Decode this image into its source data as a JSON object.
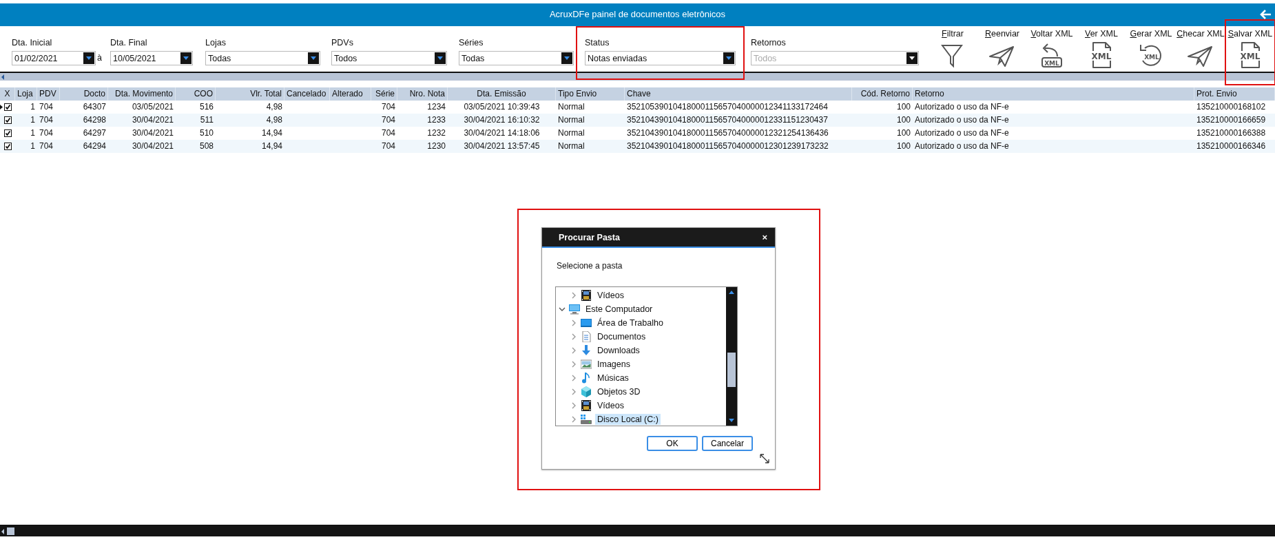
{
  "window": {
    "title": "AcruxDFe painel de documentos eletrônicos"
  },
  "filters": [
    {
      "kind": "field",
      "label": "Dta. Inicial",
      "value": "01/02/2021",
      "disabled": false,
      "highlighted": false
    },
    {
      "kind": "separator",
      "text": "à"
    },
    {
      "kind": "field",
      "label": "Dta. Final",
      "value": "10/05/2021",
      "disabled": false,
      "highlighted": false
    },
    {
      "kind": "field",
      "label": "Lojas",
      "value": "Todas",
      "disabled": false,
      "highlighted": false
    },
    {
      "kind": "field",
      "label": "PDVs",
      "value": "Todos",
      "disabled": false,
      "highlighted": false
    },
    {
      "kind": "field",
      "label": "Séries",
      "value": "Todas",
      "disabled": false,
      "highlighted": false
    },
    {
      "kind": "field",
      "label": "Status",
      "value": "Notas enviadas",
      "disabled": false,
      "highlighted": true
    },
    {
      "kind": "field",
      "label": "Retornos",
      "value": "Todos",
      "disabled": true,
      "highlighted": false
    }
  ],
  "toolbar": [
    {
      "label": "Filtrar",
      "kind": "funnel",
      "highlighted": false
    },
    {
      "label": "Reenviar",
      "kind": "plane",
      "highlighted": false
    },
    {
      "label": "Voltar XML",
      "kind": "undo",
      "badge": "XML",
      "highlighted": false
    },
    {
      "label": "Ver XML",
      "kind": "file",
      "badge": "XML",
      "highlighted": false
    },
    {
      "label": "Gerar XML",
      "kind": "refresh",
      "badge": "XML",
      "highlighted": false
    },
    {
      "label": "Checar XML",
      "kind": "plane",
      "highlighted": false
    },
    {
      "label": "Salvar XML",
      "kind": "file",
      "badge": "XML",
      "highlighted": true
    }
  ],
  "table": {
    "checkbox_column": "X",
    "columns": [
      "Loja",
      "PDV",
      "Docto",
      "Dta. Movimento",
      "COO",
      "Vlr. Total",
      "Cancelado",
      "Alterado",
      "Série",
      "Nro. Nota",
      "Dta. Emissão",
      "Tipo Envio",
      "Chave",
      "Cód. Retorno",
      "Retorno",
      "Prot. Envio"
    ],
    "rows": [
      {
        "current": true,
        "checked": true,
        "cells": [
          "1",
          "704",
          "64307",
          "03/05/2021",
          "516",
          "4,98",
          null,
          null,
          "704",
          "1234",
          "03/05/2021 10:39:43",
          "Normal",
          "35210539010418000115657040000012341133172464",
          "100",
          "Autorizado o uso da NF-e",
          "135210000168102"
        ]
      },
      {
        "current": false,
        "checked": true,
        "cells": [
          "1",
          "704",
          "64298",
          "30/04/2021",
          "511",
          "4,98",
          null,
          null,
          "704",
          "1233",
          "30/04/2021 16:10:32",
          "Normal",
          "35210439010418000115657040000012331151230437",
          "100",
          "Autorizado o uso da NF-e",
          "135210000166659"
        ]
      },
      {
        "current": false,
        "checked": true,
        "cells": [
          "1",
          "704",
          "64297",
          "30/04/2021",
          "510",
          "14,94",
          null,
          null,
          "704",
          "1232",
          "30/04/2021 14:18:06",
          "Normal",
          "35210439010418000115657040000012321254136436",
          "100",
          "Autorizado o uso da NF-e",
          "135210000166388"
        ]
      },
      {
        "current": false,
        "checked": true,
        "cells": [
          "1",
          "704",
          "64294",
          "30/04/2021",
          "508",
          "14,94",
          null,
          null,
          "704",
          "1230",
          "30/04/2021 13:57:45",
          "Normal",
          "35210439010418000115657040000012301239173232",
          "100",
          "Autorizado o uso da NF-e",
          "135210000166346"
        ]
      }
    ]
  },
  "dialog": {
    "title": "Procurar Pasta",
    "close": "×",
    "prompt": "Selecione a pasta",
    "highlighted": true,
    "tree": [
      {
        "children": [
          {
            "label": "Vídeos",
            "kind": "video",
            "expanded": false,
            "selected": false
          }
        ]
      },
      {
        "label": "Este Computador",
        "kind": "computer",
        "expanded": true,
        "selected": false,
        "children": [
          {
            "label": "Área de Trabalho",
            "kind": "desktop",
            "expanded": false,
            "selected": false
          },
          {
            "label": "Documentos",
            "kind": "documents",
            "expanded": false,
            "selected": false
          },
          {
            "label": "Downloads",
            "kind": "downloads",
            "expanded": false,
            "selected": false
          },
          {
            "label": "Imagens",
            "kind": "pictures",
            "expanded": false,
            "selected": false
          },
          {
            "label": "Músicas",
            "kind": "music",
            "expanded": false,
            "selected": false
          },
          {
            "label": "Objetos 3D",
            "kind": "objects3d",
            "expanded": false,
            "selected": false
          },
          {
            "label": "Vídeos",
            "kind": "video",
            "expanded": false,
            "selected": false
          },
          {
            "label": "Disco Local (C:)",
            "kind": "drive",
            "expanded": false,
            "selected": true
          }
        ]
      }
    ],
    "buttons": [
      "OK",
      "Cancelar"
    ]
  }
}
